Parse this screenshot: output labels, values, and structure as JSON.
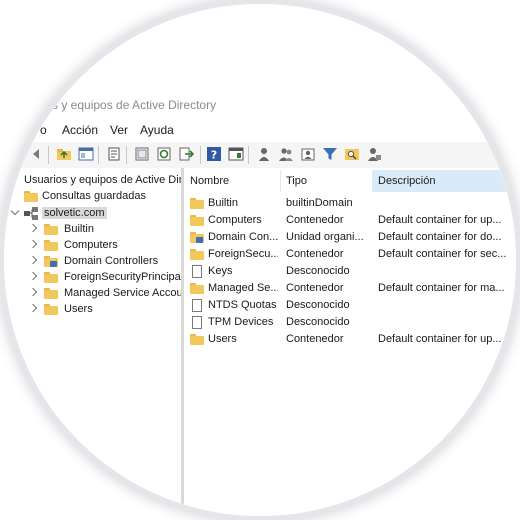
{
  "window": {
    "title": "...s y equipos de Active Directory"
  },
  "menu": {
    "file_partial": "o",
    "action": "Acción",
    "view": "Ver",
    "help": "Ayuda"
  },
  "toolbar": {
    "icons": [
      "back-arrow-icon",
      "up-folder-icon",
      "show-tree-icon",
      "copy-icon",
      "export-icon",
      "refresh-icon",
      "export-list-icon",
      "help-icon",
      "console-icon",
      "user-icon",
      "users-icon",
      "group-icon",
      "filter-icon",
      "find-icon",
      "delegate-icon"
    ]
  },
  "tree": {
    "root": "Usuarios y equipos de Active Dir",
    "saved_queries": "Consultas guardadas",
    "domain": "solvetic.com",
    "children": [
      "Builtin",
      "Computers",
      "Domain Controllers",
      "ForeignSecurityPrincipals",
      "Managed Service Accour",
      "Users"
    ]
  },
  "list": {
    "headers": {
      "name": "Nombre",
      "type": "Tipo",
      "description": "Descripción"
    },
    "rows": [
      {
        "name": "Builtin",
        "type": "builtinDomain",
        "description": "",
        "icon": "folder"
      },
      {
        "name": "Computers",
        "type": "Contenedor",
        "description": "Default container for up...",
        "icon": "folder"
      },
      {
        "name": "Domain Con...",
        "type": "Unidad organi...",
        "description": "Default container for do...",
        "icon": "ou"
      },
      {
        "name": "ForeignSecu...",
        "type": "Contenedor",
        "description": "Default container for sec...",
        "icon": "folder"
      },
      {
        "name": "Keys",
        "type": "Desconocido",
        "description": "",
        "icon": "doc"
      },
      {
        "name": "Managed Se...",
        "type": "Contenedor",
        "description": "Default container for ma...",
        "icon": "folder"
      },
      {
        "name": "NTDS Quotas",
        "type": "Desconocido",
        "description": "",
        "icon": "doc"
      },
      {
        "name": "TPM Devices",
        "type": "Desconocido",
        "description": "",
        "icon": "doc"
      },
      {
        "name": "Users",
        "type": "Contenedor",
        "description": "Default container for up...",
        "icon": "folder"
      }
    ]
  },
  "colors": {
    "header_desc_bg": "#d9ebf9",
    "folder": "#f2c85b",
    "selection": "#d9d9d9"
  }
}
